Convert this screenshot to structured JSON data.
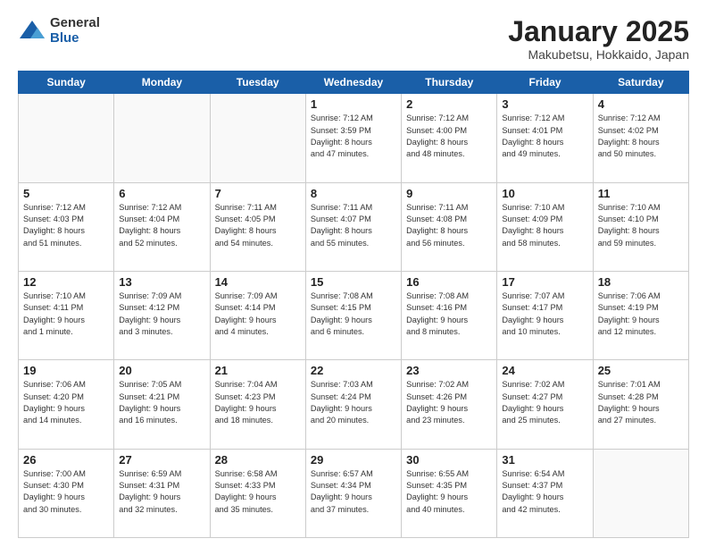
{
  "header": {
    "logo_general": "General",
    "logo_blue": "Blue",
    "title": "January 2025",
    "location": "Makubetsu, Hokkaido, Japan"
  },
  "weekdays": [
    "Sunday",
    "Monday",
    "Tuesday",
    "Wednesday",
    "Thursday",
    "Friday",
    "Saturday"
  ],
  "weeks": [
    [
      {
        "day": "",
        "info": ""
      },
      {
        "day": "",
        "info": ""
      },
      {
        "day": "",
        "info": ""
      },
      {
        "day": "1",
        "info": "Sunrise: 7:12 AM\nSunset: 3:59 PM\nDaylight: 8 hours\nand 47 minutes."
      },
      {
        "day": "2",
        "info": "Sunrise: 7:12 AM\nSunset: 4:00 PM\nDaylight: 8 hours\nand 48 minutes."
      },
      {
        "day": "3",
        "info": "Sunrise: 7:12 AM\nSunset: 4:01 PM\nDaylight: 8 hours\nand 49 minutes."
      },
      {
        "day": "4",
        "info": "Sunrise: 7:12 AM\nSunset: 4:02 PM\nDaylight: 8 hours\nand 50 minutes."
      }
    ],
    [
      {
        "day": "5",
        "info": "Sunrise: 7:12 AM\nSunset: 4:03 PM\nDaylight: 8 hours\nand 51 minutes."
      },
      {
        "day": "6",
        "info": "Sunrise: 7:12 AM\nSunset: 4:04 PM\nDaylight: 8 hours\nand 52 minutes."
      },
      {
        "day": "7",
        "info": "Sunrise: 7:11 AM\nSunset: 4:05 PM\nDaylight: 8 hours\nand 54 minutes."
      },
      {
        "day": "8",
        "info": "Sunrise: 7:11 AM\nSunset: 4:07 PM\nDaylight: 8 hours\nand 55 minutes."
      },
      {
        "day": "9",
        "info": "Sunrise: 7:11 AM\nSunset: 4:08 PM\nDaylight: 8 hours\nand 56 minutes."
      },
      {
        "day": "10",
        "info": "Sunrise: 7:10 AM\nSunset: 4:09 PM\nDaylight: 8 hours\nand 58 minutes."
      },
      {
        "day": "11",
        "info": "Sunrise: 7:10 AM\nSunset: 4:10 PM\nDaylight: 8 hours\nand 59 minutes."
      }
    ],
    [
      {
        "day": "12",
        "info": "Sunrise: 7:10 AM\nSunset: 4:11 PM\nDaylight: 9 hours\nand 1 minute."
      },
      {
        "day": "13",
        "info": "Sunrise: 7:09 AM\nSunset: 4:12 PM\nDaylight: 9 hours\nand 3 minutes."
      },
      {
        "day": "14",
        "info": "Sunrise: 7:09 AM\nSunset: 4:14 PM\nDaylight: 9 hours\nand 4 minutes."
      },
      {
        "day": "15",
        "info": "Sunrise: 7:08 AM\nSunset: 4:15 PM\nDaylight: 9 hours\nand 6 minutes."
      },
      {
        "day": "16",
        "info": "Sunrise: 7:08 AM\nSunset: 4:16 PM\nDaylight: 9 hours\nand 8 minutes."
      },
      {
        "day": "17",
        "info": "Sunrise: 7:07 AM\nSunset: 4:17 PM\nDaylight: 9 hours\nand 10 minutes."
      },
      {
        "day": "18",
        "info": "Sunrise: 7:06 AM\nSunset: 4:19 PM\nDaylight: 9 hours\nand 12 minutes."
      }
    ],
    [
      {
        "day": "19",
        "info": "Sunrise: 7:06 AM\nSunset: 4:20 PM\nDaylight: 9 hours\nand 14 minutes."
      },
      {
        "day": "20",
        "info": "Sunrise: 7:05 AM\nSunset: 4:21 PM\nDaylight: 9 hours\nand 16 minutes."
      },
      {
        "day": "21",
        "info": "Sunrise: 7:04 AM\nSunset: 4:23 PM\nDaylight: 9 hours\nand 18 minutes."
      },
      {
        "day": "22",
        "info": "Sunrise: 7:03 AM\nSunset: 4:24 PM\nDaylight: 9 hours\nand 20 minutes."
      },
      {
        "day": "23",
        "info": "Sunrise: 7:02 AM\nSunset: 4:26 PM\nDaylight: 9 hours\nand 23 minutes."
      },
      {
        "day": "24",
        "info": "Sunrise: 7:02 AM\nSunset: 4:27 PM\nDaylight: 9 hours\nand 25 minutes."
      },
      {
        "day": "25",
        "info": "Sunrise: 7:01 AM\nSunset: 4:28 PM\nDaylight: 9 hours\nand 27 minutes."
      }
    ],
    [
      {
        "day": "26",
        "info": "Sunrise: 7:00 AM\nSunset: 4:30 PM\nDaylight: 9 hours\nand 30 minutes."
      },
      {
        "day": "27",
        "info": "Sunrise: 6:59 AM\nSunset: 4:31 PM\nDaylight: 9 hours\nand 32 minutes."
      },
      {
        "day": "28",
        "info": "Sunrise: 6:58 AM\nSunset: 4:33 PM\nDaylight: 9 hours\nand 35 minutes."
      },
      {
        "day": "29",
        "info": "Sunrise: 6:57 AM\nSunset: 4:34 PM\nDaylight: 9 hours\nand 37 minutes."
      },
      {
        "day": "30",
        "info": "Sunrise: 6:55 AM\nSunset: 4:35 PM\nDaylight: 9 hours\nand 40 minutes."
      },
      {
        "day": "31",
        "info": "Sunrise: 6:54 AM\nSunset: 4:37 PM\nDaylight: 9 hours\nand 42 minutes."
      },
      {
        "day": "",
        "info": ""
      }
    ]
  ]
}
